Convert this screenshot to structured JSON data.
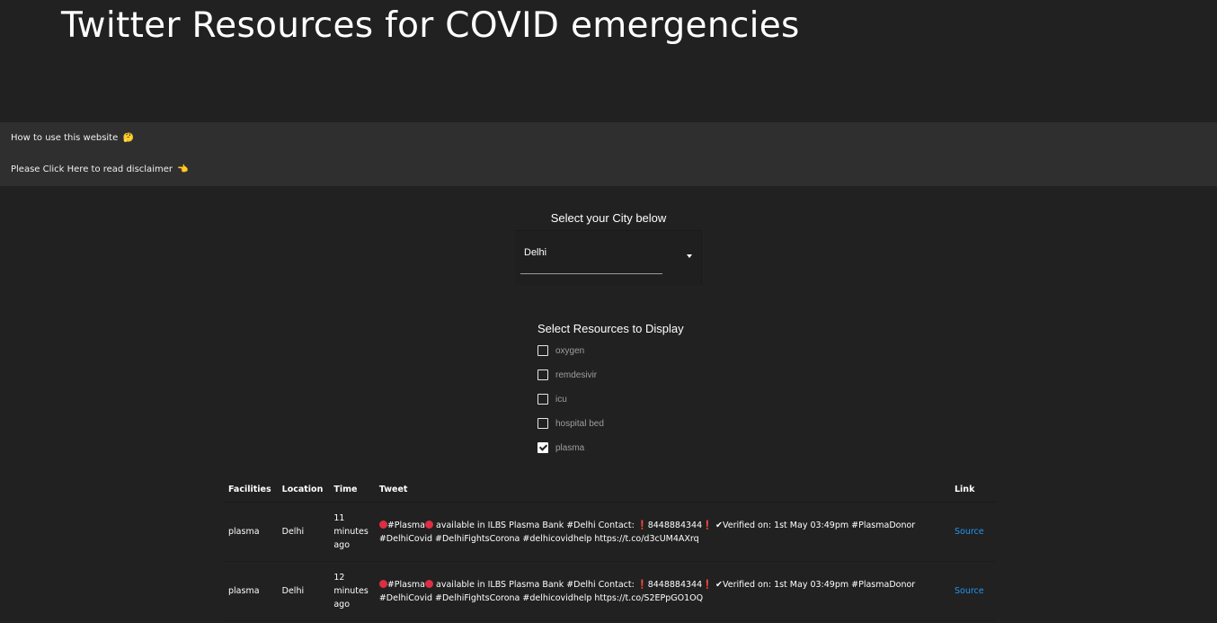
{
  "header": {
    "title": "Twitter Resources for COVID emergencies"
  },
  "info": {
    "how_to": "How to use this website",
    "how_to_emoji": "🤔",
    "disclaimer": "Please Click Here to read disclaimer",
    "disclaimer_emoji": "👈"
  },
  "city": {
    "label": "Select your City below",
    "selected": "Delhi"
  },
  "resources": {
    "label": "Select Resources to Display",
    "options": [
      {
        "label": "oxygen",
        "checked": false
      },
      {
        "label": "remdesivir",
        "checked": false
      },
      {
        "label": "icu",
        "checked": false
      },
      {
        "label": "hospital bed",
        "checked": false
      },
      {
        "label": "plasma",
        "checked": true
      }
    ]
  },
  "table": {
    "headers": [
      "Facilities",
      "Location",
      "Time",
      "Tweet",
      "Link"
    ],
    "rows": [
      {
        "facility": "plasma",
        "location": "Delhi",
        "time": "11 minutes ago",
        "tweet_a": "#Plasma",
        "tweet_b": " available in ILBS Plasma Bank #Delhi Contact: ",
        "tweet_c": "8448884344",
        "tweet_d": " ✔Verified on: 1st May 03:49pm #PlasmaDonor #DelhiCovid #DelhiFightsCorona #delhicovidhelp https://t.co/d3cUM4AXrq",
        "link": "Source"
      },
      {
        "facility": "plasma",
        "location": "Delhi",
        "time": "12 minutes ago",
        "tweet_a": "#Plasma",
        "tweet_b": " available in ILBS Plasma Bank #Delhi Contact: ",
        "tweet_c": "8448884344",
        "tweet_d": " ✔Verified on: 1st May 03:49pm #PlasmaDonor #DelhiCovid #DelhiFightsCorona #delhicovidhelp https://t.co/S2EPpGO1OQ",
        "link": "Source"
      }
    ]
  },
  "colors": {
    "background": "#212121",
    "infobar": "#2f2f2f",
    "link": "#2196f3",
    "accent_red": "#dd2e44"
  }
}
